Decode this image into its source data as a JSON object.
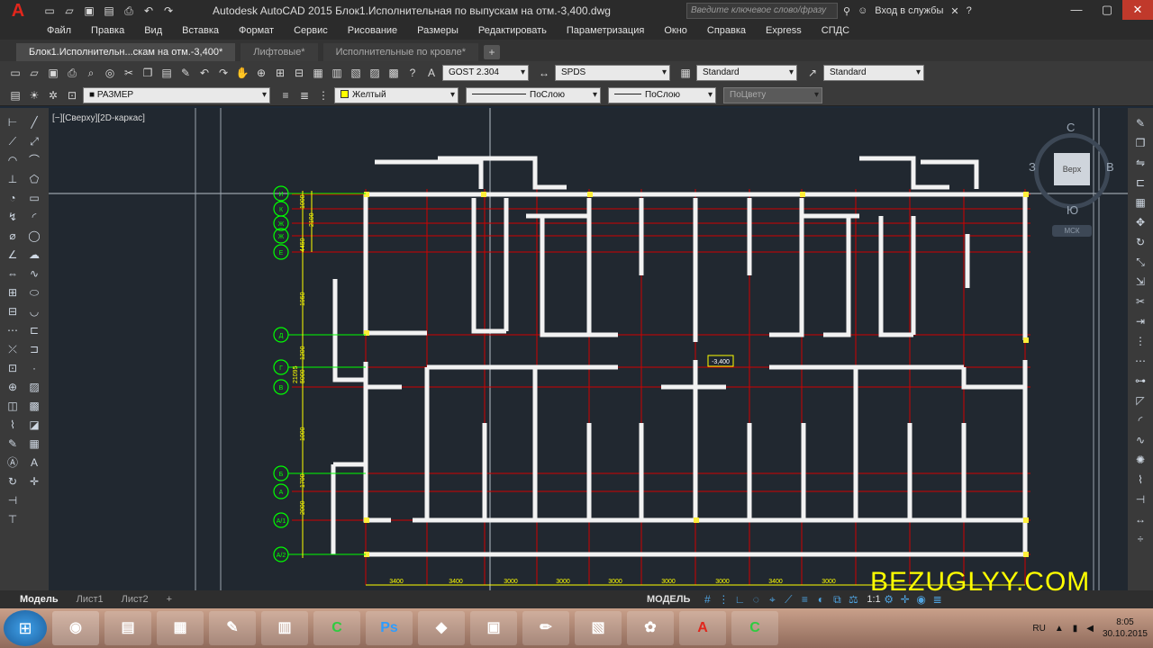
{
  "titlebar": {
    "app_logo": "A",
    "title": "Autodesk AutoCAD 2015   Блок1.Исполнительная по выпускам на отм.-3,400.dwg",
    "search_placeholder": "Введите ключевое слово/фразу",
    "signin_label": "Вход в службы",
    "help_label": "?"
  },
  "menu": [
    "Файл",
    "Правка",
    "Вид",
    "Вставка",
    "Формат",
    "Сервис",
    "Рисование",
    "Размеры",
    "Редактировать",
    "Параметризация",
    "Окно",
    "Справка",
    "Express",
    "СПДС"
  ],
  "tabs": [
    {
      "label": "Блок1.Исполнительн...скам на отм.-3,400*",
      "active": true
    },
    {
      "label": "Лифтовые*",
      "active": false
    },
    {
      "label": "Исполнительные по кровле*",
      "active": false
    }
  ],
  "styles": {
    "text_style": "GOST 2.304",
    "dim_style": "SPDS",
    "table_style": "Standard",
    "multileader_style": "Standard"
  },
  "layers": {
    "current_layer": "РАЗМЕР",
    "color": "Желтый",
    "linetype": "ПоСлою",
    "lineweight": "ПоСлою",
    "plotstyle": "ПоЦвету"
  },
  "viewport": {
    "label": "[−][Сверху][2D-каркас]",
    "viewcube": {
      "n": "С",
      "s": "Ю",
      "w": "З",
      "e": "В",
      "face": "Верх",
      "wcs": "МСК"
    }
  },
  "drawing": {
    "grid_labels_left": [
      "И",
      "К",
      "Ж",
      "Ж",
      "Е",
      "Д",
      "Г",
      "В",
      "Б",
      "А",
      "А/1",
      "А/2"
    ],
    "dims_vertical": [
      "1000",
      "2100",
      "4450",
      "1950",
      "1200",
      "5000",
      "1000",
      "1700",
      "2000",
      "21095"
    ],
    "dims_bottom": [
      "3400",
      "3400",
      "3000",
      "3000",
      "3000",
      "3000",
      "3000",
      "3400",
      "3000"
    ],
    "elevation_tag": "-3,400"
  },
  "layout_tabs": [
    "Модель",
    "Лист1",
    "Лист2"
  ],
  "status": {
    "model_label": "МОДЕЛЬ",
    "scale": "1:1"
  },
  "watermark": "BEZUGLYY.COM",
  "taskbar": {
    "lang": "RU",
    "time": "8:05",
    "date": "30.10.2015"
  }
}
